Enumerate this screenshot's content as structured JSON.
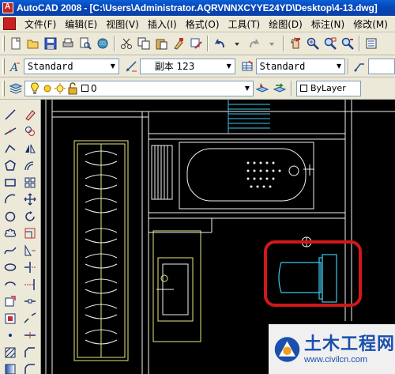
{
  "window": {
    "title": "AutoCAD 2008 - [C:\\Users\\Administrator.AQRVNNXCYYE24YD\\Desktop\\4-13.dwg]"
  },
  "menubar": {
    "items": [
      "文件(F)",
      "编辑(E)",
      "视图(V)",
      "插入(I)",
      "格式(O)",
      "工具(T)",
      "绘图(D)",
      "标注(N)",
      "修改(M)"
    ]
  },
  "styles_toolbar": {
    "text_style": "Standard",
    "dim_style": "副本 123",
    "table_style": "Standard"
  },
  "layers_toolbar": {
    "layer_name": "0",
    "color_control": "ByLayer"
  },
  "watermark": {
    "title": "土木工程网",
    "url": "www.civilcn.com"
  },
  "colors": {
    "canvas": "#000000",
    "drawing_yellow": "#e8e880",
    "drawing_white": "#f0f0f0",
    "drawing_cyan": "#3cc8e8",
    "highlight_red": "#d01818",
    "title_blue": "#0a5fd8"
  }
}
